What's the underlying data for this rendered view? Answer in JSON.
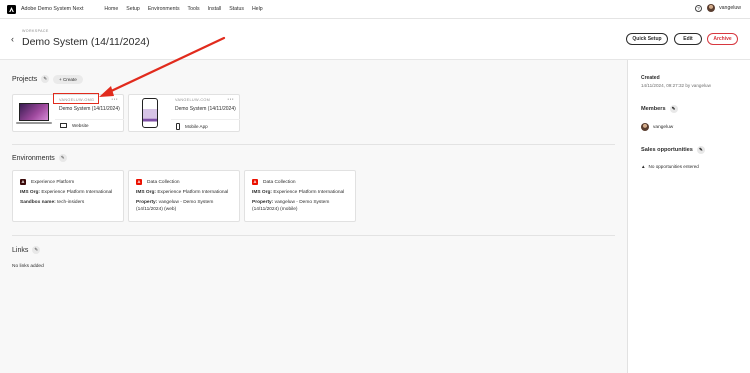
{
  "topnav": {
    "app_name": "Adobe Demo System Next",
    "links": [
      "Home",
      "Setup",
      "Environments",
      "Tools",
      "Install",
      "Status",
      "Help"
    ],
    "help_glyph": "?",
    "user": "vangeluw"
  },
  "header": {
    "kicker": "WORKSPACE",
    "title": "Demo System (14/11/2024)",
    "quick_setup": "Quick Setup",
    "edit": "Edit",
    "archive": "Archive"
  },
  "projects": {
    "title": "Projects",
    "create": "Create",
    "items": [
      {
        "meta": "VANGELUW-OMG",
        "name": "Demo System (14/11/2024)",
        "type": "Website",
        "icon": "monitor-icon"
      },
      {
        "meta": "VANGELUW-COM",
        "name": "Demo System (14/11/2024)",
        "type": "Mobile App",
        "icon": "mobile-icon"
      }
    ]
  },
  "environments": {
    "title": "Environments",
    "items": [
      {
        "name": "Experience Platform",
        "org_label": "IMS Org:",
        "org": "Experience Platform International",
        "extra_label": "Sandbox name:",
        "extra": "tech-insiders",
        "extra_2": "",
        "logo_color": "#3b0a0a"
      },
      {
        "name": "Data Collection",
        "org_label": "IMS Org:",
        "org": "Experience Platform International",
        "extra_label": "Property:",
        "extra": "vangeluw - Demo System",
        "extra_2": "(14/11/2024) (web)",
        "logo_color": "#eb1000"
      },
      {
        "name": "Data Collection",
        "org_label": "IMS Org:",
        "org": "Experience Platform International",
        "extra_label": "Property:",
        "extra": "vangeluw - Demo System",
        "extra_2": "(14/11/2024) (mobile)",
        "logo_color": "#eb1000"
      }
    ]
  },
  "links": {
    "title": "Links",
    "empty": "No links added"
  },
  "sidebar": {
    "created_label": "Created",
    "created_value": "14/11/2024, 09:27:32 by vangeluw",
    "members_title": "Members",
    "member": "vangeluw",
    "sales_title": "Sales opportunities",
    "sales_empty": "No opportunities entered"
  },
  "colors": {
    "accent_red": "#d7373f",
    "annotation_red": "#e12b1d"
  }
}
